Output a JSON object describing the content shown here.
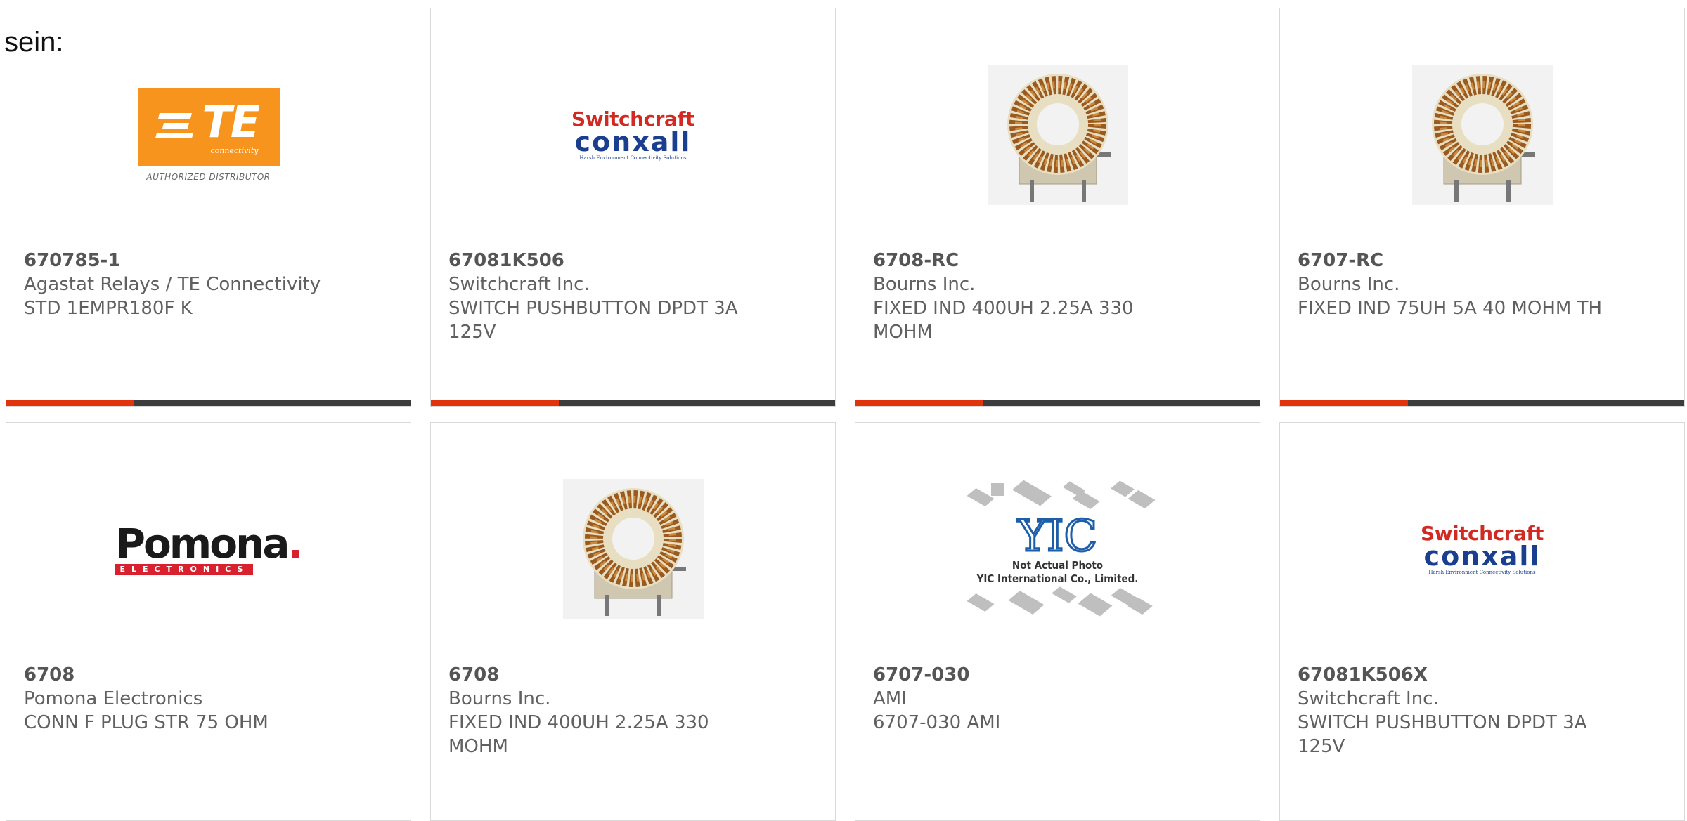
{
  "intro_text": "sein:",
  "colors": {
    "accent": "#e2340c",
    "bar": "#3c3c3c",
    "border": "#d9d9d9",
    "text": "#606060"
  },
  "logos": {
    "te": {
      "letters": "TE",
      "sub": "connectivity",
      "auth": "AUTHORIZED DISTRIBUTOR"
    },
    "switchcraft": {
      "top": "Switchcraft",
      "mid": "conxall",
      "sub": "Harsh Environment Connectivity Solutions"
    },
    "pomona": {
      "top": "Pomona",
      "sub": "ELECTRONICS"
    },
    "yic": {
      "mark": "YIC",
      "note_line1": "Not Actual Photo",
      "note_line2": "YIC International Co., Limited."
    }
  },
  "products": [
    {
      "part": "670785-1",
      "manufacturer": "Agastat Relays / TE Connectivity",
      "description": "STD 1EMPR180F K",
      "image": "te-logo"
    },
    {
      "part": "67081K506",
      "manufacturer": "Switchcraft Inc.",
      "description": "SWITCH PUSHBUTTON DPDT 3A 125V",
      "image": "switchcraft-logo"
    },
    {
      "part": "6708-RC",
      "manufacturer": "Bourns Inc.",
      "description": "FIXED IND 400UH 2.25A 330 MOHM",
      "image": "toroid-inductor"
    },
    {
      "part": "6707-RC",
      "manufacturer": "Bourns Inc.",
      "description": "FIXED IND 75UH 5A 40 MOHM TH",
      "image": "toroid-inductor"
    },
    {
      "part": "6708",
      "manufacturer": "Pomona Electronics",
      "description": "CONN F PLUG STR 75 OHM",
      "image": "pomona-logo"
    },
    {
      "part": "6708",
      "manufacturer": "Bourns Inc.",
      "description": "FIXED IND 400UH 2.25A 330 MOHM",
      "image": "toroid-inductor"
    },
    {
      "part": "6707-030",
      "manufacturer": "AMI",
      "description": "6707-030 AMI",
      "image": "yic-placeholder"
    },
    {
      "part": "67081K506X",
      "manufacturer": "Switchcraft Inc.",
      "description": "SWITCH PUSHBUTTON DPDT 3A 125V",
      "image": "switchcraft-logo"
    }
  ]
}
